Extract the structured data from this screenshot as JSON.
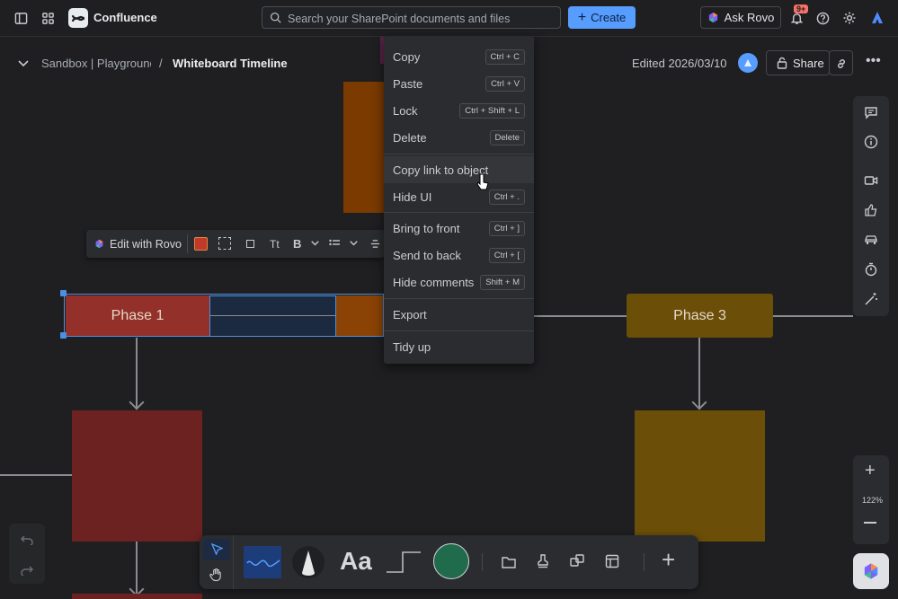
{
  "topbar": {
    "app_name": "Confluence",
    "search_placeholder": "Search your SharePoint documents and files",
    "create_label": "Create",
    "ask_rovo_label": "Ask Rovo",
    "notifications_badge": "9+"
  },
  "page": {
    "breadcrumb_parent": "Sandbox | Playground",
    "breadcrumb_sep": "/",
    "title": "Whiteboard Timeline",
    "edited": "Edited 2026/03/10",
    "share_label": "Share"
  },
  "floating_toolbar": {
    "edit_with_rovo": "Edit with Rovo",
    "text_style": "Tt",
    "bold": "B",
    "fill_color": "#c0392b"
  },
  "context_menu": {
    "items": [
      {
        "label": "Copy",
        "shortcut": "Ctrl + C"
      },
      {
        "label": "Paste",
        "shortcut": "Ctrl + V"
      },
      {
        "label": "Lock",
        "shortcut": "Ctrl + Shift + L"
      },
      {
        "label": "Delete",
        "shortcut": "Delete"
      },
      {
        "label": "Copy link to object",
        "shortcut": ""
      },
      {
        "label": "Hide UI",
        "shortcut": "Ctrl + ."
      },
      {
        "label": "Bring to front",
        "shortcut": "Ctrl + ]"
      },
      {
        "label": "Send to back",
        "shortcut": "Ctrl + ["
      },
      {
        "label": "Hide comments",
        "shortcut": "Shift + M"
      },
      {
        "label": "Export",
        "shortcut": ""
      },
      {
        "label": "Tidy up",
        "shortcut": ""
      }
    ]
  },
  "canvas": {
    "phase1_label": "Phase 1",
    "phase3_label": "Phase 3",
    "colors": {
      "phase1": "#93302a",
      "phase2": "#8a4205",
      "phase3": "#6b4e08",
      "card_red": "#6b2220",
      "card_orange": "#7a3a00",
      "card_olive": "#6b4e08",
      "selection": "#4a90e2"
    }
  },
  "zoom": {
    "level": "122%"
  },
  "bottom_toolbar": {
    "text_tool": "Aa",
    "icons": [
      "select-icon",
      "hand-icon",
      "pen-icon",
      "shape-icon",
      "text-icon",
      "connector-icon",
      "color-icon",
      "frame-icon",
      "stamp-icon",
      "sticker-icon",
      "template-icon",
      "add-icon"
    ]
  }
}
